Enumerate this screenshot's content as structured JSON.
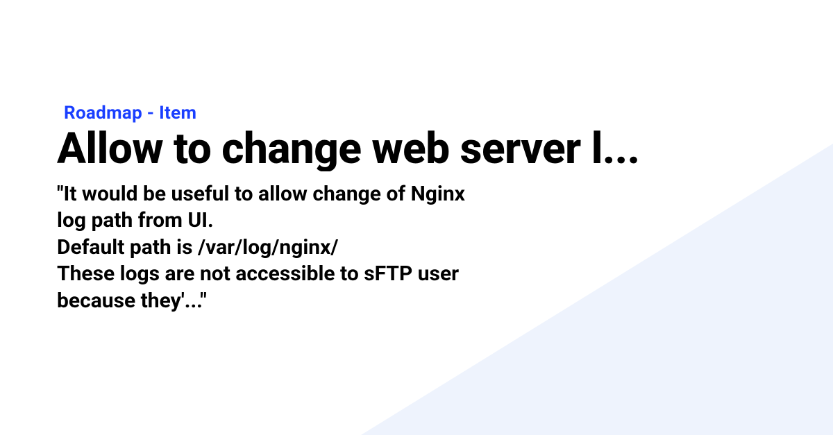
{
  "card": {
    "category": "Roadmap - Item",
    "title": "Allow to change web server l...",
    "description": "\"It would be useful to allow change of Nginx log path from UI.\nDefault path is /var/log/nginx/\nThese logs are not accessible to sFTP user because they'...\""
  }
}
